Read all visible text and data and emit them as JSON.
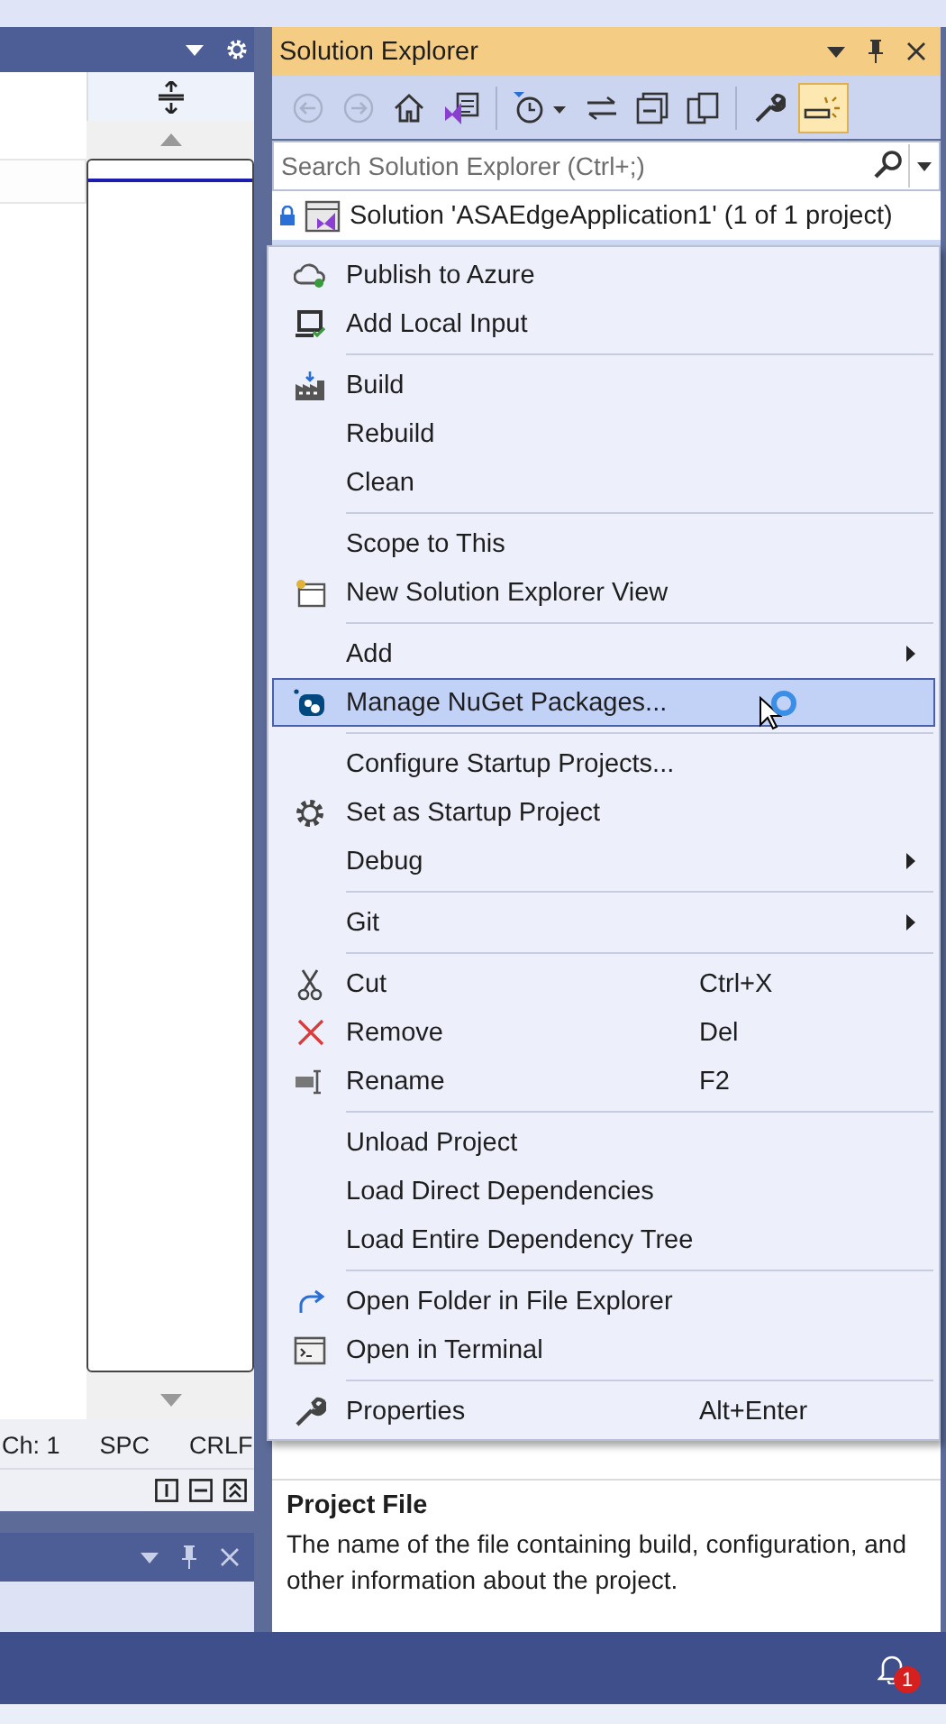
{
  "left_pane": {
    "status_bar": [
      "Ch: 1",
      "SPC",
      "CRLF"
    ]
  },
  "solution_explorer": {
    "title": "Solution Explorer",
    "toolbar": [
      {
        "disabled": true,
        "selected": false
      },
      {
        "disabled": true,
        "selected": false
      },
      {
        "disabled": false,
        "selected": false
      },
      {
        "disabled": false,
        "selected": false
      },
      {
        "disabled": false,
        "selected": false
      },
      {
        "disabled": false,
        "selected": false
      },
      {
        "disabled": false,
        "selected": false
      },
      {
        "disabled": false,
        "selected": false
      },
      {
        "disabled": false,
        "selected": false
      },
      {
        "disabled": false,
        "selected": true
      }
    ],
    "search": {
      "placeholder": "Search Solution Explorer (Ctrl+;)"
    },
    "solution_node": "Solution 'ASAEdgeApplication1' (1 of 1 project)"
  },
  "context_menu": {
    "groups": [
      {
        "items": [
          {
            "label": "Publish to Azure",
            "submenu": false,
            "selected": false
          },
          {
            "label": "Add Local Input",
            "submenu": false,
            "selected": false
          }
        ]
      },
      {
        "items": [
          {
            "label": "Build",
            "submenu": false,
            "selected": false
          },
          {
            "label": "Rebuild",
            "submenu": false,
            "selected": false
          },
          {
            "label": "Clean",
            "submenu": false,
            "selected": false
          }
        ]
      },
      {
        "items": [
          {
            "label": "Scope to This",
            "submenu": false,
            "selected": false
          },
          {
            "label": "New Solution Explorer View",
            "submenu": false,
            "selected": false
          }
        ]
      },
      {
        "items": [
          {
            "label": "Add",
            "submenu": true,
            "selected": false
          },
          {
            "label": "Manage NuGet Packages...",
            "submenu": false,
            "selected": true
          }
        ]
      },
      {
        "items": [
          {
            "label": "Configure Startup Projects...",
            "submenu": false,
            "selected": false
          },
          {
            "label": "Set as Startup Project",
            "submenu": false,
            "selected": false
          },
          {
            "label": "Debug",
            "submenu": true,
            "selected": false
          }
        ]
      },
      {
        "items": [
          {
            "label": "Git",
            "submenu": true,
            "selected": false
          }
        ]
      },
      {
        "items": [
          {
            "label": "Cut",
            "shortcut": "Ctrl+X",
            "submenu": false,
            "selected": false
          },
          {
            "label": "Remove",
            "shortcut": "Del",
            "submenu": false,
            "selected": false
          },
          {
            "label": "Rename",
            "shortcut": "F2",
            "submenu": false,
            "selected": false
          }
        ]
      },
      {
        "items": [
          {
            "label": "Unload Project",
            "submenu": false,
            "selected": false
          },
          {
            "label": "Load Direct Dependencies",
            "submenu": false,
            "selected": false
          },
          {
            "label": "Load Entire Dependency Tree",
            "submenu": false,
            "selected": false
          }
        ]
      },
      {
        "items": [
          {
            "label": "Open Folder in File Explorer",
            "submenu": false,
            "selected": false
          },
          {
            "label": "Open in Terminal",
            "submenu": false,
            "selected": false
          }
        ]
      },
      {
        "items": [
          {
            "label": "Properties",
            "shortcut": "Alt+Enter",
            "submenu": false,
            "selected": false
          }
        ]
      }
    ]
  },
  "description": {
    "title": "Project File",
    "text": "The name of the file containing build, configuration, and other information about the project."
  },
  "notifications": {
    "badge": "1"
  }
}
